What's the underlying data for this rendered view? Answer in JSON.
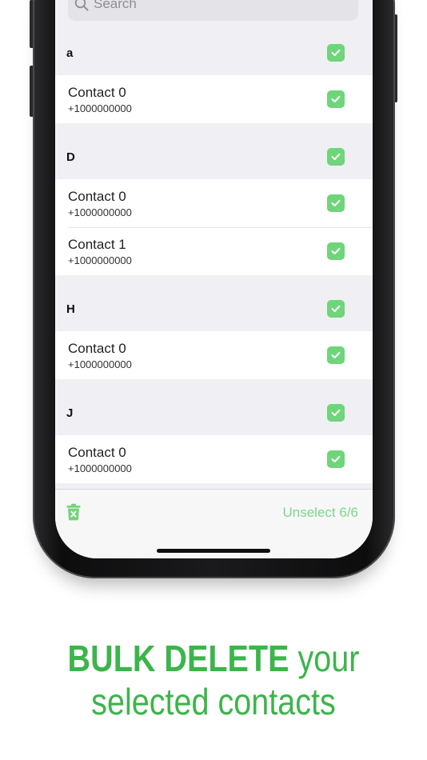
{
  "search": {
    "placeholder": "Search"
  },
  "sections": [
    {
      "letter": "a",
      "contacts": [
        {
          "name": "Contact 0",
          "phone": "+1000000000"
        }
      ]
    },
    {
      "letter": "D",
      "contacts": [
        {
          "name": "Contact 0",
          "phone": "+1000000000"
        },
        {
          "name": "Contact 1",
          "phone": "+1000000000"
        }
      ]
    },
    {
      "letter": "H",
      "contacts": [
        {
          "name": "Contact 0",
          "phone": "+1000000000"
        }
      ]
    },
    {
      "letter": "J",
      "contacts": [
        {
          "name": "Contact 0",
          "phone": "+1000000000"
        }
      ]
    }
  ],
  "toolbar": {
    "unselect_label": "Unselect 6/6"
  },
  "caption": {
    "bold": "BULK DELETE",
    "rest": "your",
    "line2": "selected contacts"
  },
  "colors": {
    "accent": "#3cb54a",
    "checkbox": "#6fd57a",
    "link": "#7bd68a"
  }
}
